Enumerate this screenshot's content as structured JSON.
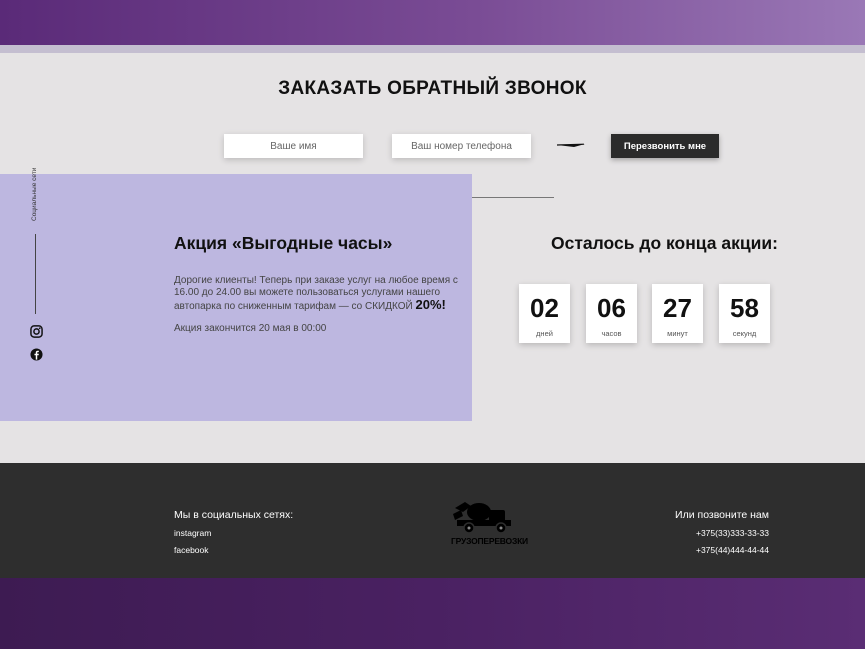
{
  "callback": {
    "title": "ЗАКАЗАТЬ ОБРАТНЫЙ ЗВОНОК",
    "name_placeholder": "Ваше имя",
    "phone_placeholder": "Ваш номер телефона",
    "submit_label": "Перезвонить мне"
  },
  "sidebar": {
    "social_label": "Социальные сети",
    "icons": [
      "instagram-icon",
      "facebook-icon"
    ]
  },
  "promo": {
    "title": "Акция «Выгодные часы»",
    "text": "Дорогие клиенты! Теперь при заказе услуг на любое время с 16.00 до 24.00 вы можете пользоваться услугами нашего автопарка по сниженным тарифам — со СКИДКОЙ",
    "discount": "20%!",
    "end_note": "Акция закончится 20 мая в 00:00",
    "panel_color": "#bdb7e0"
  },
  "countdown": {
    "title": "Осталось до конца акции:",
    "items": [
      {
        "value": "02",
        "unit": "дней"
      },
      {
        "value": "06",
        "unit": "часов"
      },
      {
        "value": "27",
        "unit": "минут"
      },
      {
        "value": "58",
        "unit": "секунд"
      }
    ]
  },
  "footer": {
    "social_title": "Мы в социальных сетях:",
    "social_links": [
      "instagram",
      "facebook"
    ],
    "logo_text": "ГРУЗОПЕРЕВОЗКИ",
    "call_title": "Или позвоните нам",
    "phones": [
      "+375(33)333-33-33",
      "+375(44)444-44-44"
    ]
  }
}
